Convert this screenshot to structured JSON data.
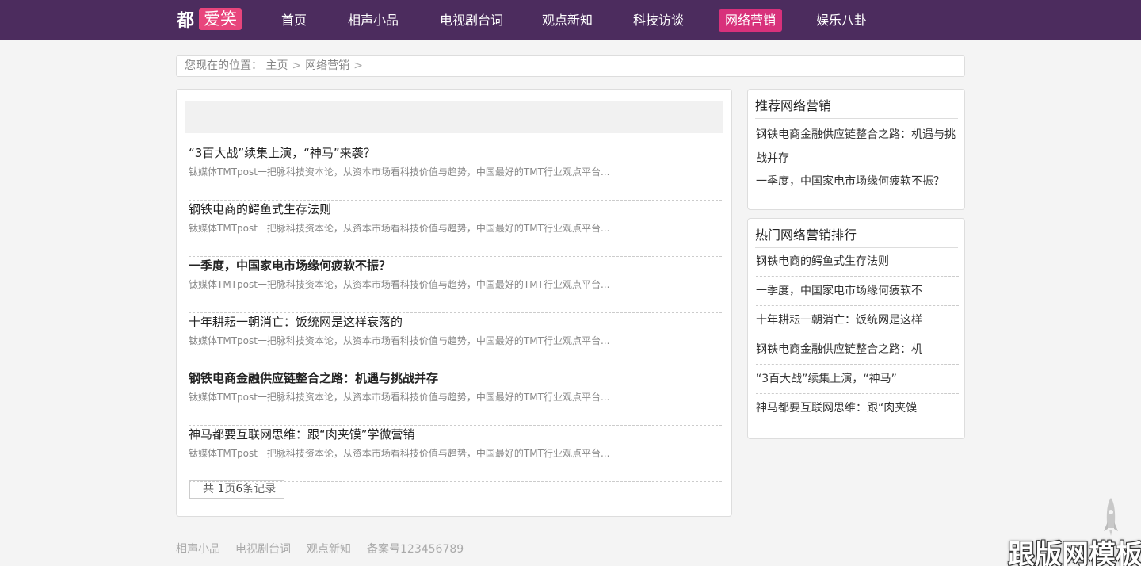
{
  "header": {
    "logo_text": "都",
    "logo_badge": "爱笑",
    "nav": [
      "首页",
      "相声小品",
      "电视剧台词",
      "观点新知",
      "科技访谈",
      "网络营销",
      "娱乐八卦"
    ],
    "active_index": 5,
    "colors": {
      "bar": "#4c2c5e",
      "active": "#d8317b",
      "badge": "#e8457c"
    }
  },
  "breadcrumb": {
    "prefix": "您现在的位置：",
    "home": "主页",
    "current": "网络营销",
    "separator": ">"
  },
  "articles": [
    {
      "title": "“3百大战”续集上演，“神马”来袭？",
      "desc": "钛媒体TMTpost一把脉科技资本论，从资本市场看科技价值与趋势，中国最好的TMT行业观点平台...",
      "bold": false
    },
    {
      "title": "钢铁电商的鳄鱼式生存法则",
      "desc": "钛媒体TMTpost一把脉科技资本论，从资本市场看科技价值与趋势，中国最好的TMT行业观点平台...",
      "bold": false
    },
    {
      "title": "一季度，中国家电市场缘何疲软不振？",
      "desc": "钛媒体TMTpost一把脉科技资本论，从资本市场看科技价值与趋势，中国最好的TMT行业观点平台...",
      "bold": true
    },
    {
      "title": "十年耕耘一朝消亡：饭统网是这样衰落的",
      "desc": "钛媒体TMTpost一把脉科技资本论，从资本市场看科技价值与趋势，中国最好的TMT行业观点平台...",
      "bold": false
    },
    {
      "title": "钢铁电商金融供应链整合之路：机遇与挑战并存",
      "desc": "钛媒体TMTpost一把脉科技资本论，从资本市场看科技价值与趋势，中国最好的TMT行业观点平台...",
      "bold": true
    },
    {
      "title": "神马都要互联网思维：跟“肉夹馍”学微营销",
      "desc": "钛媒体TMTpost一把脉科技资本论，从资本市场看科技价值与趋势，中国最好的TMT行业观点平台...",
      "bold": false
    }
  ],
  "pager": {
    "prefix": "共 ",
    "pages": "1",
    "mid": "页",
    "count": "6",
    "suffix": "条记录"
  },
  "recommend": {
    "title": "推荐网络营销",
    "items": [
      "钢铁电商金融供应链整合之路：机遇与挑战并存",
      "一季度，中国家电市场缘何疲软不振？"
    ]
  },
  "hot": {
    "title": "热门网络营销排行",
    "items": [
      "钢铁电商的鳄鱼式生存法则",
      "一季度，中国家电市场缘何疲软不",
      "十年耕耘一朝消亡：饭统网是这样",
      "钢铁电商金融供应链整合之路：机",
      "“3百大战”续集上演，“神马”",
      "神马都要互联网思维：跟“肉夹馍"
    ]
  },
  "footer": {
    "links": [
      "相声小品",
      "电视剧台词",
      "观点新知"
    ],
    "icp": "备案号123456789"
  },
  "watermark": "跟版网模板"
}
